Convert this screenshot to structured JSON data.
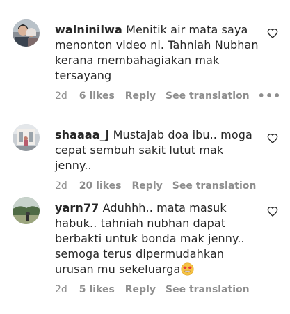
{
  "comments": [
    {
      "username": "walninilwa",
      "text": "Menitik air mata saya menonton video ni. Tahniah Nubhan kerana membahagiakan mak tersayang",
      "time": "2d",
      "likes": "6 likes",
      "reply": "Reply",
      "translate": "See translation",
      "more": "•••"
    },
    {
      "username": "shaaaa_j",
      "text": "Mustajab doa ibu.. moga cepat sembuh sakit lutut mak jenny..",
      "time": "2d",
      "likes": "20 likes",
      "reply": "Reply",
      "translate": "See translation"
    },
    {
      "username": "yarn77",
      "text": "Aduhhh.. mata masuk habuk.. tahniah nubhan dapat berbakti untuk bonda mak jenny.. semoga terus dipermudahkan urusan mu sekeluarga",
      "emoji": "star-struck-emoji",
      "time": "2d",
      "likes": "5 likes",
      "reply": "Reply",
      "translate": "See translation"
    }
  ],
  "icons": {
    "heart": "heart-outline-icon",
    "more": "more-options-icon"
  },
  "colors": {
    "text": "#262626",
    "secondary": "#8e8e8e",
    "background": "#ffffff"
  }
}
